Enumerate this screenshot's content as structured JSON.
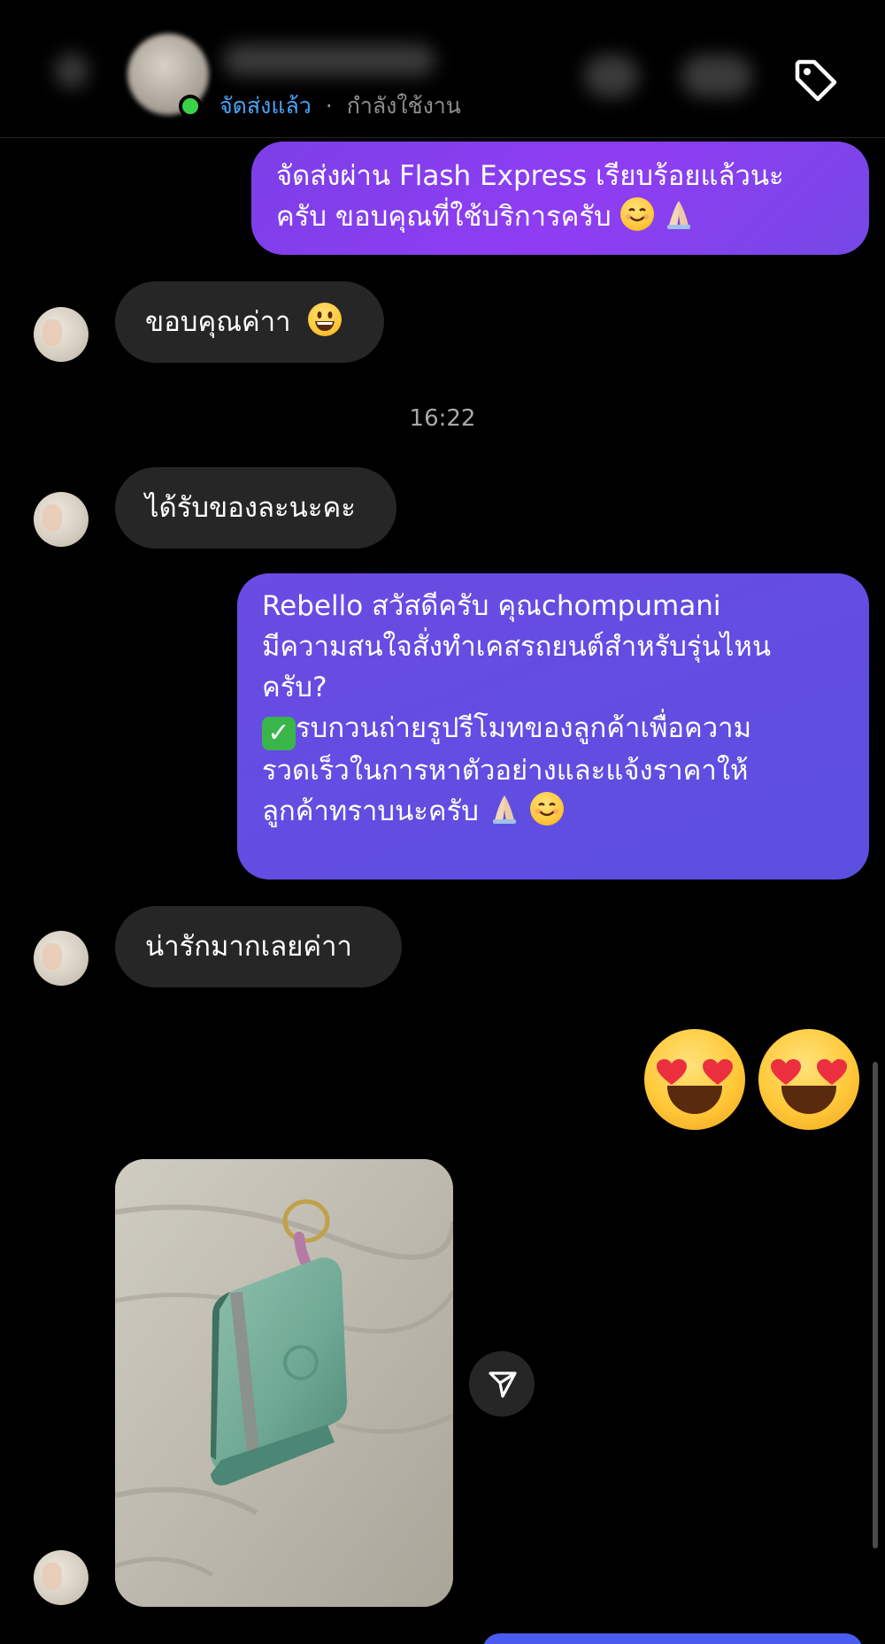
{
  "header": {
    "status_primary": "จัดส่งแล้ว",
    "status_separator": "·",
    "status_secondary": "กำลังใช้งาน"
  },
  "messages": [
    {
      "direction": "outgoing",
      "lines": [
        "จัดส่งผ่าน Flash Express เรียบร้อยแล้วนะ",
        "ครับ ขอบคุณที่ใช้บริการครับ"
      ]
    },
    {
      "direction": "incoming",
      "text": "ขอบคุณค่าา"
    },
    {
      "direction": "incoming",
      "text": "ได้รับของละนะคะ"
    },
    {
      "direction": "outgoing",
      "lines": [
        "Rebello สวัสดีครับ คุณchompumani",
        "มีความสนใจสั่งทำเคสรถยนต์สำหรับรุ่นไหน",
        "ครับ?",
        "รบกวนถ่ายรูปรีโมทของลูกค้าเพื่อความ",
        "รวดเร็วในการหาตัวอย่างและแจ้งราคาให้",
        "ลูกค้าทราบนะครับ"
      ]
    },
    {
      "direction": "incoming",
      "text": "น่ารักมากเลยค่าา"
    }
  ],
  "timestamp": "16:22",
  "icons": {
    "tag": "tag-icon",
    "share": "paper-plane-icon",
    "big_emoji": "smiling-face-with-heart-eyes-icon"
  },
  "colors": {
    "outgoing_bubble": "#8a3df0",
    "outgoing_bubble_2": "#5f4ee2",
    "incoming_bubble": "#262626",
    "online": "#3bd24a",
    "status_link": "#4aa3f5"
  }
}
